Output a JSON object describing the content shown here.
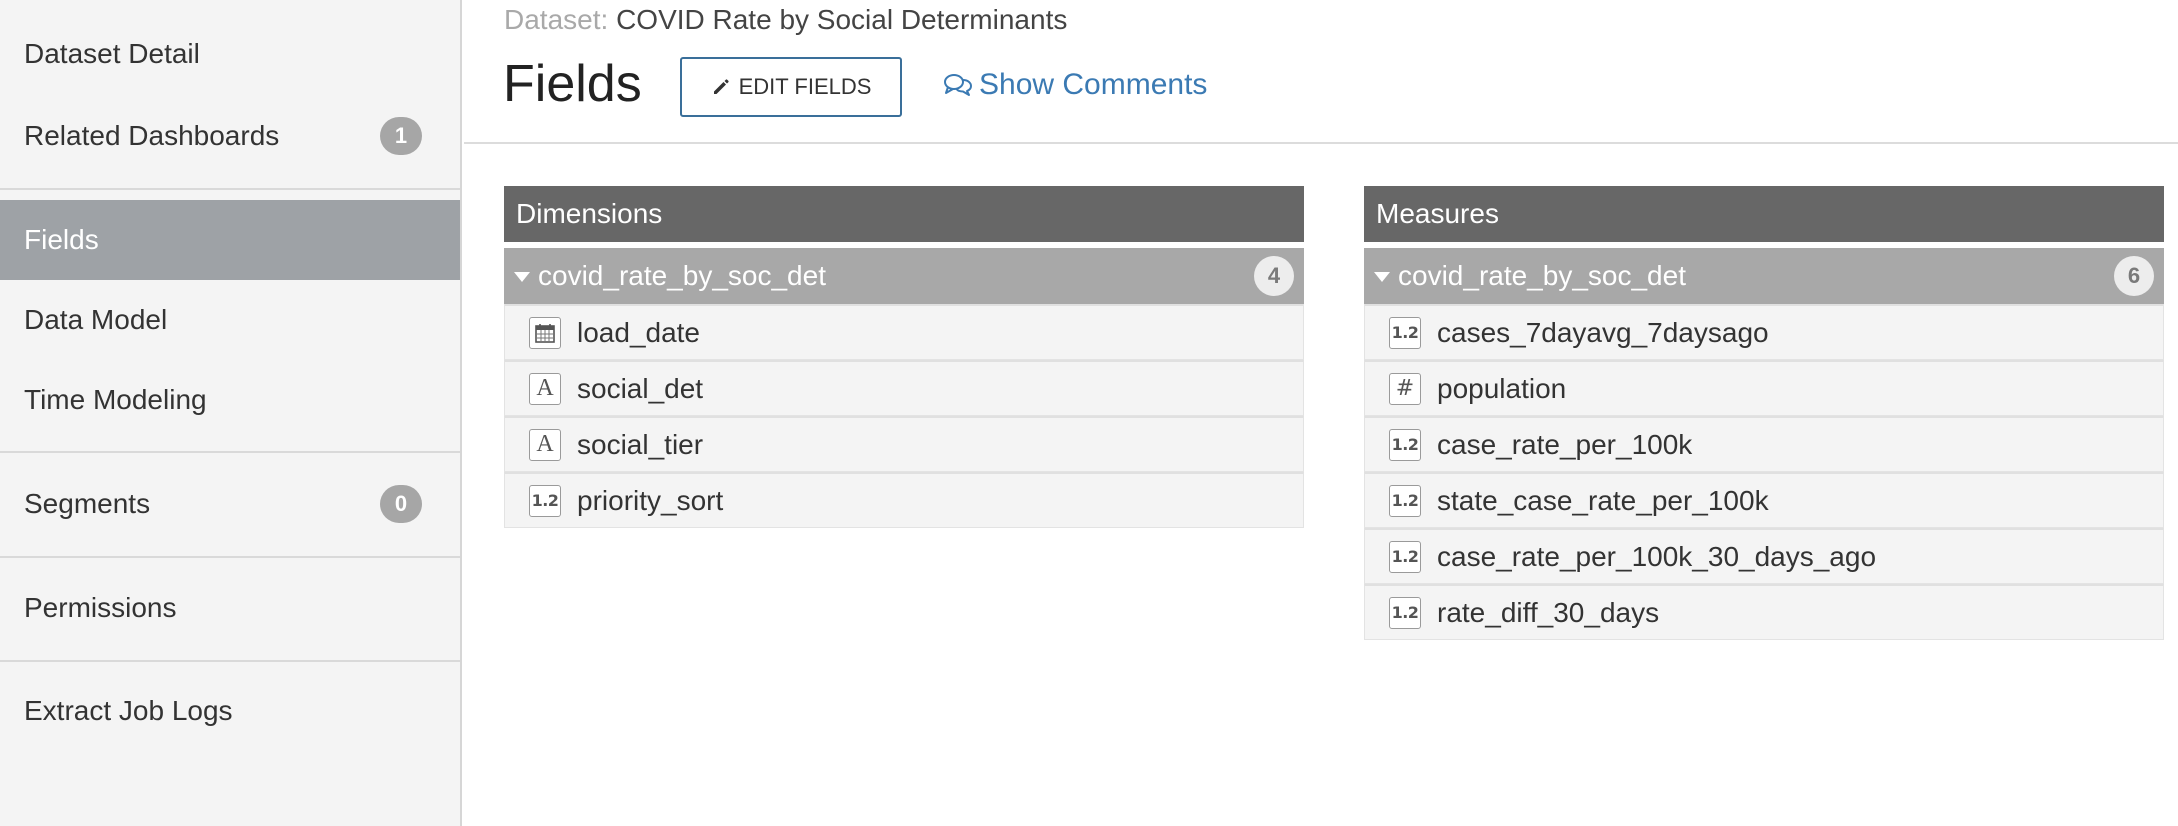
{
  "sidebar": {
    "items": [
      {
        "label": "Dataset Detail"
      },
      {
        "label": "Related Dashboards",
        "badge": "1"
      },
      {
        "label": "Fields",
        "active": true
      },
      {
        "label": "Data Model"
      },
      {
        "label": "Time Modeling"
      },
      {
        "label": "Segments",
        "badge": "0"
      },
      {
        "label": "Permissions"
      },
      {
        "label": "Extract Job Logs"
      }
    ]
  },
  "header": {
    "dataset_prefix": "Dataset:",
    "dataset_name": "COVID Rate by Social Determinants",
    "title": "Fields",
    "edit_label": "EDIT FIELDS",
    "comments_label": "Show Comments"
  },
  "dimensions": {
    "title": "Dimensions",
    "group": {
      "name": "covid_rate_by_soc_det",
      "count": "4"
    },
    "fields": [
      {
        "name": "load_date",
        "icon": "calendar-icon"
      },
      {
        "name": "social_det",
        "icon": "text-type-icon"
      },
      {
        "name": "social_tier",
        "icon": "text-type-icon"
      },
      {
        "name": "priority_sort",
        "icon": "decimal-type-icon"
      }
    ]
  },
  "measures": {
    "title": "Measures",
    "group": {
      "name": "covid_rate_by_soc_det",
      "count": "6"
    },
    "fields": [
      {
        "name": "cases_7dayavg_7daysago",
        "icon": "decimal-type-icon"
      },
      {
        "name": "population",
        "icon": "integer-type-icon"
      },
      {
        "name": "case_rate_per_100k",
        "icon": "decimal-type-icon"
      },
      {
        "name": "state_case_rate_per_100k",
        "icon": "decimal-type-icon"
      },
      {
        "name": "case_rate_per_100k_30_days_ago",
        "icon": "decimal-type-icon"
      },
      {
        "name": "rate_diff_30_days",
        "icon": "decimal-type-icon"
      }
    ]
  },
  "icon_glyphs": {
    "decimal": "1.2",
    "integer": "#",
    "text": "A"
  },
  "colors": {
    "active_nav": "#9ea2a6",
    "panel_header": "#676767",
    "group_row": "#a8a8a8",
    "link": "#3b7ab3",
    "button_border": "#3a6f9a"
  }
}
